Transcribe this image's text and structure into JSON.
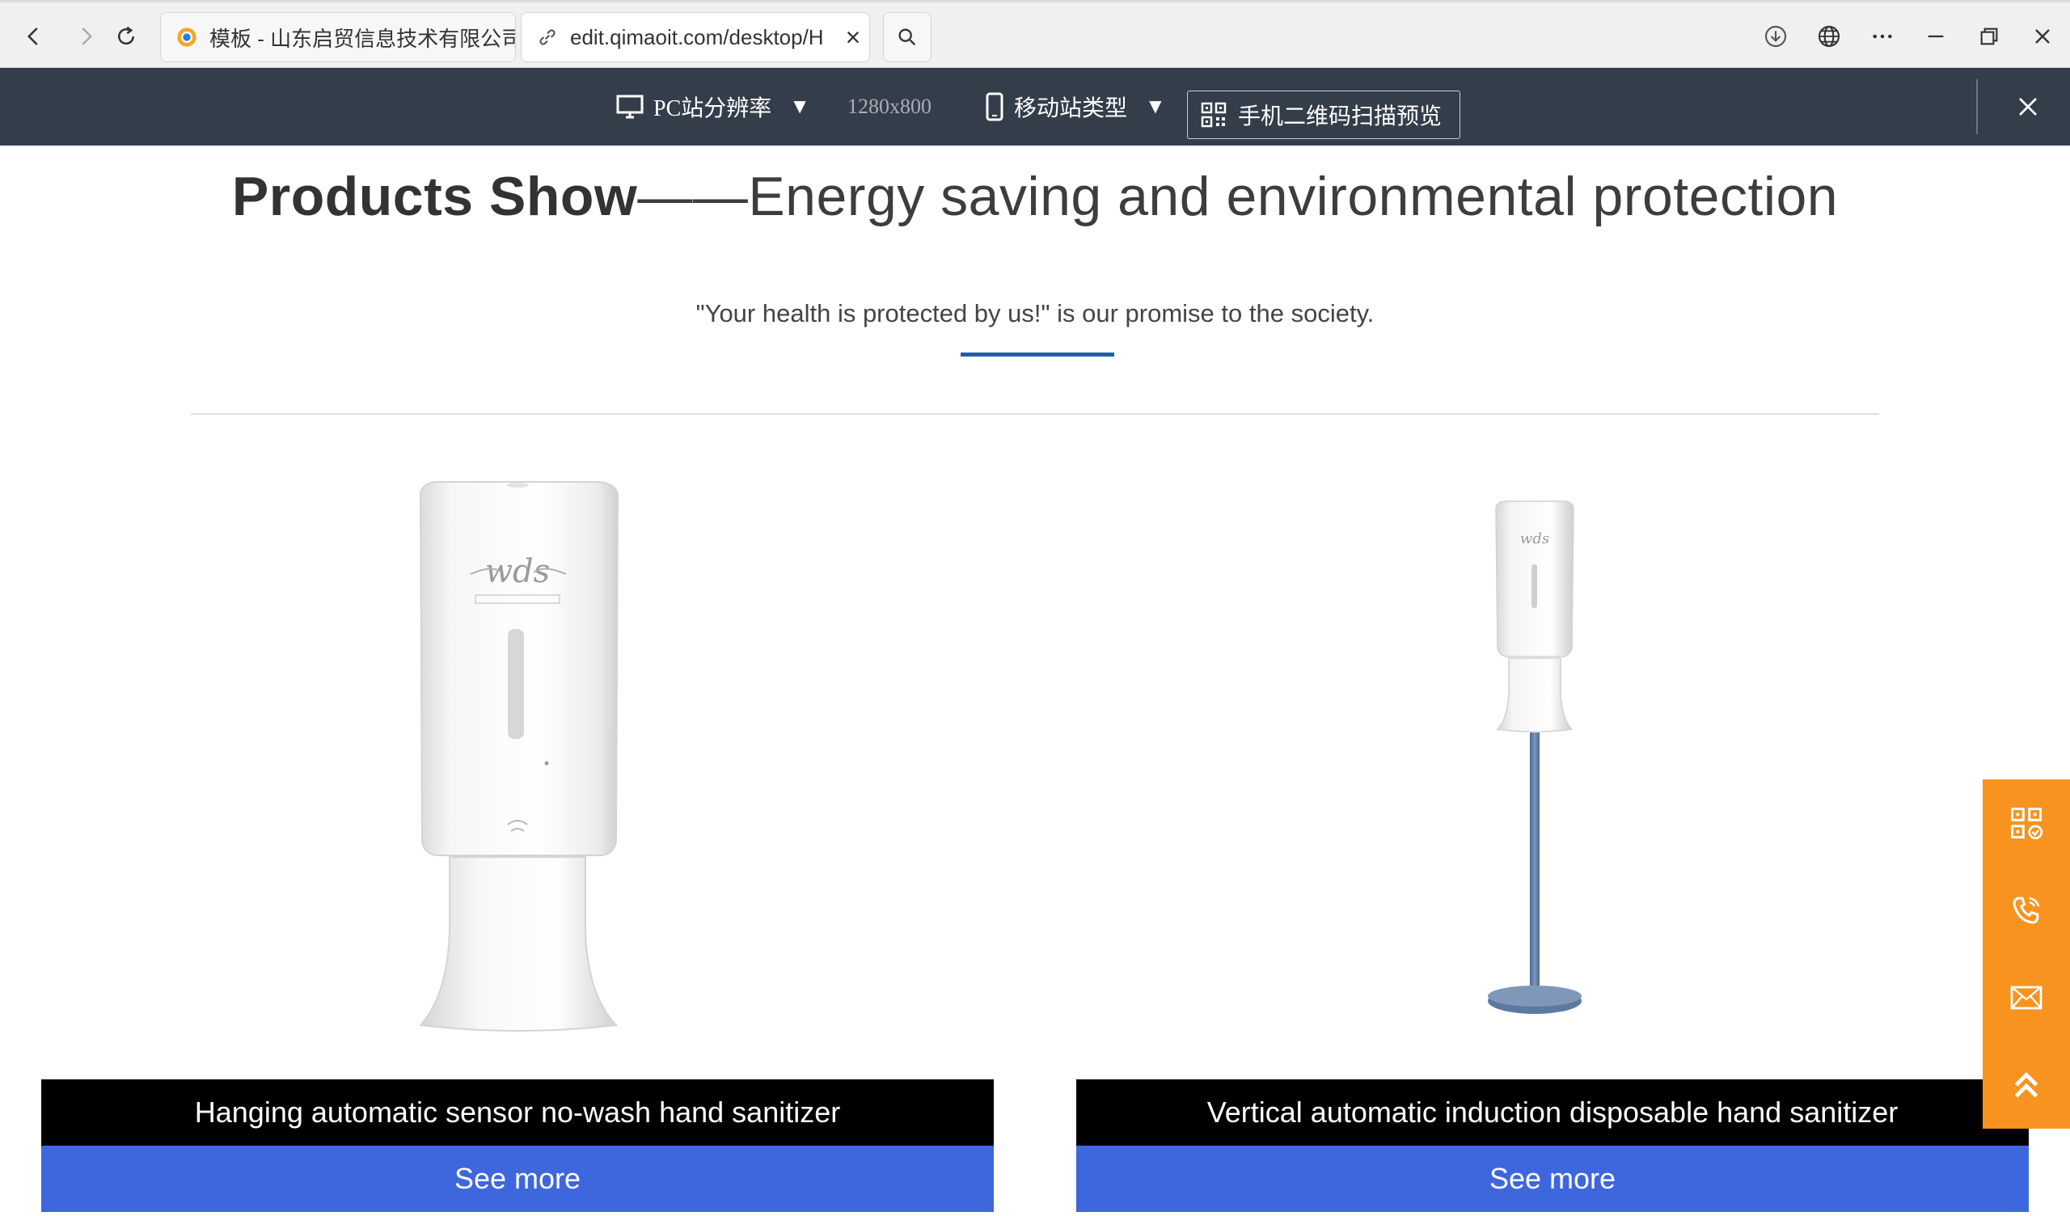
{
  "browser": {
    "tabs": [
      {
        "title": "模板 - 山东启贸信息技术有限公司",
        "active": false
      },
      {
        "title": "edit.qimaoit.com/desktop/H",
        "active": true
      }
    ]
  },
  "toolbar": {
    "pc_label": "PC站分辨率",
    "pc_resolution": "1280x800",
    "mobile_label": "移动站类型",
    "qr_label": "手机二维码扫描预览"
  },
  "section": {
    "title_bold": "Products Show",
    "title_rest": "——Energy saving and environmental protection",
    "subtitle": "\"Your health is protected by us!\" is our promise to the society.",
    "accent_color": "#1e5fa8"
  },
  "products": [
    {
      "caption": "Hanging automatic sensor no-wash hand sanitizer",
      "button": "See more",
      "image": "wall-dispenser-image",
      "brand": "wds"
    },
    {
      "caption": "Vertical automatic induction disposable hand sanitizer",
      "button": "See more",
      "image": "floor-stand-dispenser-image",
      "brand": "wds"
    }
  ],
  "float_bar": {
    "color": "#f7931e",
    "icons": [
      "qr-code-icon",
      "phone-icon",
      "mail-icon",
      "back-to-top-icon"
    ]
  }
}
